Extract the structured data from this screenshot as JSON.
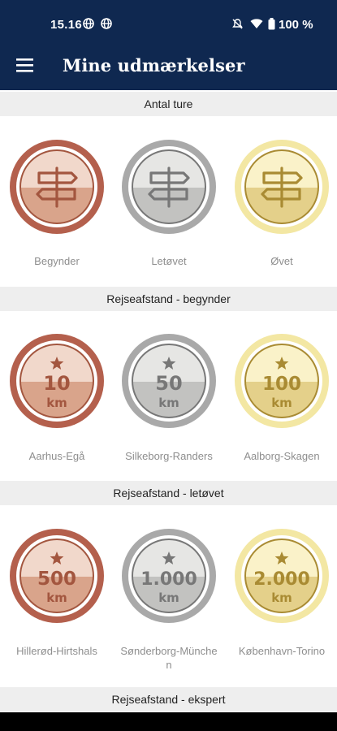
{
  "status_bar": {
    "time": "15.16",
    "battery": "100 %",
    "icons": [
      "globe-icon",
      "globe-icon",
      "mute-icon",
      "wifi-icon",
      "battery-icon"
    ]
  },
  "app_bar": {
    "menu_icon": "hamburger-menu-icon",
    "title": "Mine udmærkelser"
  },
  "sections": [
    {
      "title": "Antal ture",
      "medals": [
        {
          "kind": "signpost",
          "tier": "bronze",
          "label": "Begynder"
        },
        {
          "kind": "signpost",
          "tier": "silver",
          "label": "Letøvet"
        },
        {
          "kind": "signpost",
          "tier": "gold",
          "label": "Øvet"
        }
      ]
    },
    {
      "title": "Rejseafstand - begynder",
      "medals": [
        {
          "kind": "distance",
          "tier": "bronze",
          "value": "10",
          "unit": "km",
          "label": "Aarhus-Egå"
        },
        {
          "kind": "distance",
          "tier": "silver",
          "value": "50",
          "unit": "km",
          "label": "Silkeborg-Randers"
        },
        {
          "kind": "distance",
          "tier": "gold",
          "value": "100",
          "unit": "km",
          "label": "Aalborg-Skagen"
        }
      ]
    },
    {
      "title": "Rejseafstand - letøvet",
      "medals": [
        {
          "kind": "distance",
          "tier": "bronze",
          "value": "500",
          "unit": "km",
          "label": "Hillerød-Hirtshals"
        },
        {
          "kind": "distance",
          "tier": "silver",
          "value": "1.000",
          "unit": "km",
          "label": "Sønderborg-München"
        },
        {
          "kind": "distance",
          "tier": "gold",
          "value": "2.000",
          "unit": "km",
          "label": "København-Torino"
        }
      ]
    },
    {
      "title": "Rejseafstand - ekspert",
      "medals": []
    }
  ],
  "colors": {
    "header_bg": "#0f2850",
    "bronze": {
      "ring": "#b4604d",
      "light": "#f1d8cb",
      "dark": "#d9a48b",
      "icon": "#a3563f"
    },
    "silver": {
      "ring": "#a9a9a9",
      "light": "#e6e6e4",
      "dark": "#c2c2c0",
      "icon": "#777777"
    },
    "gold": {
      "ring": "#f3e7a3",
      "light": "#faf2c9",
      "dark": "#e4d08a",
      "icon": "#a98b33"
    }
  }
}
